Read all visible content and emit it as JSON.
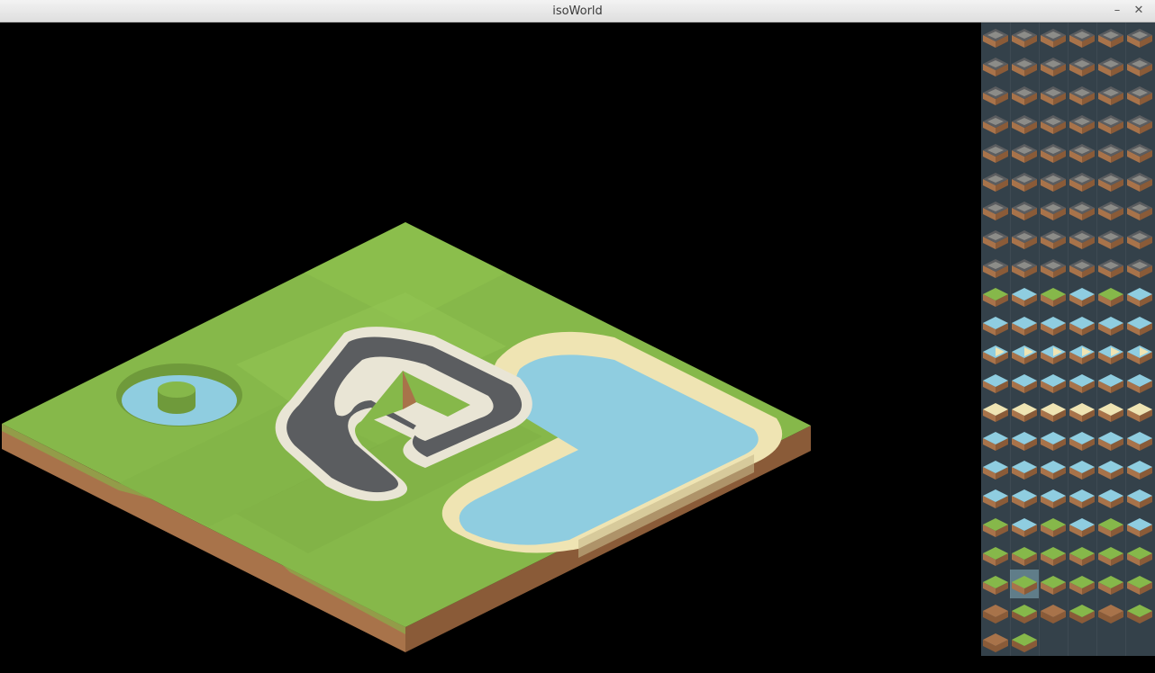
{
  "window": {
    "title": "isoWorld",
    "minimize_icon": "minimize-icon",
    "close_icon": "close-icon",
    "minimize_glyph": "–",
    "close_glyph": "✕"
  },
  "scene": {
    "description_icons": [
      "grass-terrain",
      "pond-with-island",
      "race-track",
      "lake-with-beach"
    ]
  },
  "palette": {
    "rows": 22,
    "columns": 6,
    "selected_row": 19,
    "selected_col": 1,
    "colors": {
      "background": "#34414a",
      "grass": "#86b84a",
      "grass_dark": "#6f9a3b",
      "dirt": "#a8734a",
      "dirt_dark": "#8a5b38",
      "road": "#5b5d60",
      "road_edge": "#e9e5d5",
      "water": "#8fcde0",
      "sand": "#efe4b3"
    },
    "row_types": [
      "road",
      "road",
      "road-grass",
      "road",
      "road-wall",
      "road-wall",
      "road-curve",
      "road-water",
      "road-bridge",
      "grass-water",
      "water",
      "water-sand",
      "water",
      "sand-water",
      "water-edge",
      "water-edge",
      "water-cliff",
      "grass-water",
      "grass",
      "grass-slope",
      "dirt",
      "dirt"
    ],
    "last_row_count": 2
  }
}
